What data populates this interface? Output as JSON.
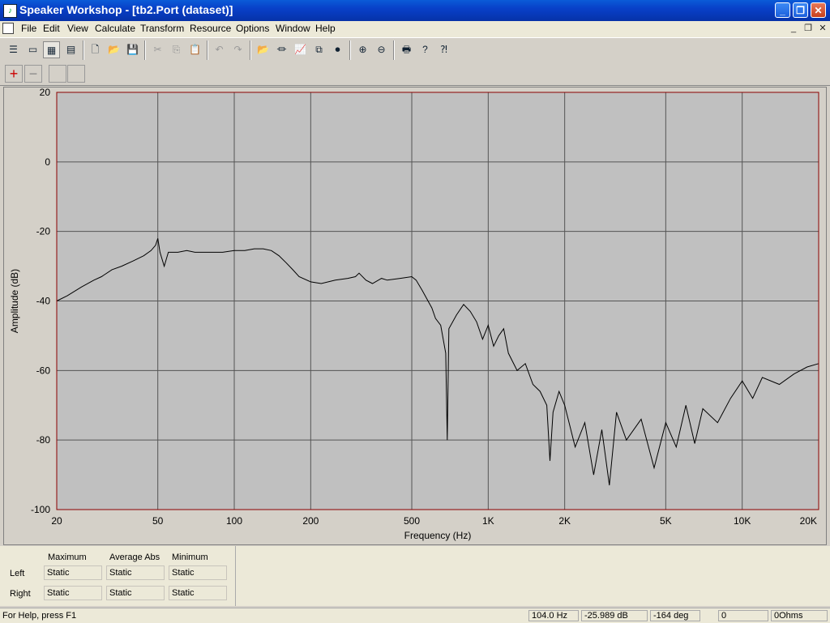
{
  "window": {
    "title": "Speaker Workshop - [tb2.Port (dataset)]",
    "minimize": "_",
    "restore": "❐",
    "close": "✕"
  },
  "menubar": {
    "items": [
      "File",
      "Edit",
      "View",
      "Calculate",
      "Transform",
      "Resource",
      "Options",
      "Window",
      "Help"
    ]
  },
  "colors": {
    "plot_bg": "#c0c0c0",
    "grid": "#555555",
    "trace": "#000000",
    "border": "#8b0000"
  },
  "chart_data": {
    "type": "line",
    "xlabel": "Frequency (Hz)",
    "ylabel": "Amplitude (dB)",
    "x_scale": "log",
    "xlim": [
      20,
      20000
    ],
    "ylim": [
      -100,
      20
    ],
    "x_ticks": [
      20,
      50,
      100,
      200,
      500,
      1000,
      2000,
      5000,
      10000,
      20000
    ],
    "x_tick_labels": [
      "20",
      "50",
      "100",
      "200",
      "500",
      "1K",
      "2K",
      "5K",
      "10K",
      "20K"
    ],
    "y_ticks": [
      20,
      0,
      -20,
      -40,
      -60,
      -80,
      -100
    ],
    "y_tick_labels": [
      "20",
      "0",
      "-20",
      "-40",
      "-60",
      "-80",
      "-100"
    ],
    "grid": true,
    "series": [
      {
        "x": [
          20,
          22,
          25,
          28,
          30,
          33,
          36,
          40,
          44,
          47,
          49,
          50,
          51,
          53,
          55,
          60,
          65,
          70,
          80,
          90,
          100,
          110,
          120,
          130,
          140,
          150,
          160,
          170,
          180,
          200,
          220,
          250,
          280,
          300,
          310,
          330,
          350,
          380,
          400,
          450,
          500,
          520,
          550,
          600,
          620,
          650,
          680,
          690,
          700,
          750,
          800,
          850,
          900,
          950,
          1000,
          1050,
          1100,
          1150,
          1200,
          1300,
          1400,
          1500,
          1600,
          1700,
          1750,
          1800,
          1900,
          2000,
          2200,
          2400,
          2600,
          2800,
          3000,
          3200,
          3500,
          4000,
          4500,
          5000,
          5500,
          6000,
          6500,
          7000,
          8000,
          9000,
          10000,
          11000,
          12000,
          14000,
          16000,
          18000,
          20000
        ],
        "y": [
          -40,
          -38.5,
          -36,
          -34,
          -33,
          -31,
          -30,
          -28.5,
          -27,
          -25.5,
          -24,
          -22,
          -26,
          -30,
          -26,
          -26,
          -25.5,
          -26,
          -26,
          -26,
          -25.5,
          -25.5,
          -25,
          -25,
          -25.5,
          -27,
          -29,
          -31,
          -33,
          -34.5,
          -35,
          -34,
          -33.5,
          -33,
          -32,
          -34,
          -35,
          -33.5,
          -34,
          -33.5,
          -33,
          -34,
          -37,
          -42,
          -45,
          -47,
          -55,
          -80,
          -48,
          -44,
          -41,
          -43,
          -46,
          -51,
          -47,
          -53,
          -50,
          -48,
          -55,
          -60,
          -58,
          -64,
          -66,
          -70,
          -86,
          -72,
          -66,
          -70,
          -82,
          -75,
          -90,
          -77,
          -93,
          -72,
          -80,
          -74,
          -88,
          -75,
          -82,
          -70,
          -81,
          -71,
          -75,
          -68,
          -63,
          -68,
          -62,
          -64,
          -61,
          -59,
          -58
        ]
      }
    ]
  },
  "bottom_panel": {
    "headers": [
      "Maximum",
      "Average Abs",
      "Minimum"
    ],
    "rows": [
      {
        "label": "Left",
        "values": [
          "Static",
          "Static",
          "Static"
        ]
      },
      {
        "label": "Right",
        "values": [
          "Static",
          "Static",
          "Static"
        ]
      }
    ]
  },
  "statusbar": {
    "help": "For Help, press F1",
    "frequency": "104.0 Hz",
    "amplitude": "-25.989 dB",
    "phase": "-164 deg",
    "value": "0",
    "impedance": "0Ohms"
  }
}
